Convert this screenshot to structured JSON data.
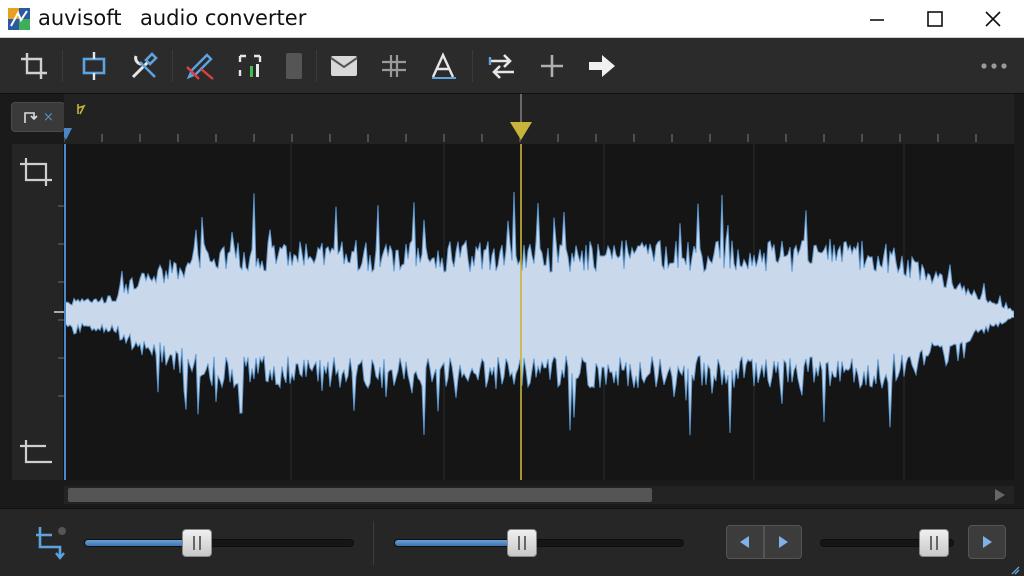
{
  "window": {
    "brand": "auvisoft",
    "title": "audio converter",
    "controls": [
      "minimize",
      "maximize",
      "close"
    ]
  },
  "toolbar": {
    "tools": [
      {
        "name": "crop-tool",
        "icon": "crop-icon"
      },
      {
        "name": "frame-tool",
        "icon": "frame-icon"
      },
      {
        "name": "tools-settings",
        "icon": "wrench-screwdriver-icon"
      },
      {
        "name": "edit-tool",
        "icon": "pencil-icon"
      },
      {
        "name": "select-tool",
        "icon": "selection-icon"
      },
      {
        "name": "panel-tool",
        "icon": "panel-icon"
      },
      {
        "name": "mail-tool",
        "icon": "envelope-icon"
      },
      {
        "name": "split-tool",
        "icon": "split-icon"
      },
      {
        "name": "text-tool",
        "icon": "text-icon"
      },
      {
        "name": "swap-tool",
        "icon": "swap-arrows-icon"
      },
      {
        "name": "add-tool",
        "icon": "plus-icon"
      },
      {
        "name": "forward-tool",
        "icon": "arrow-right-icon"
      },
      {
        "name": "more-tool",
        "icon": "more-dots-icon"
      }
    ]
  },
  "editor": {
    "loop_tab_close": "×",
    "playhead_color": "#c8b43a",
    "waveform_color": "#c9d8ea",
    "waveform_edge_color": "#5f9ad2"
  },
  "controls": {
    "slider1_fraction": 0.42,
    "slider2_fraction": 0.44,
    "slider3_fraction": 0.85,
    "buttons": [
      "previous",
      "next",
      "play"
    ]
  },
  "colors": {
    "accent": "#4a86c8",
    "background": "#1e1e1e"
  }
}
